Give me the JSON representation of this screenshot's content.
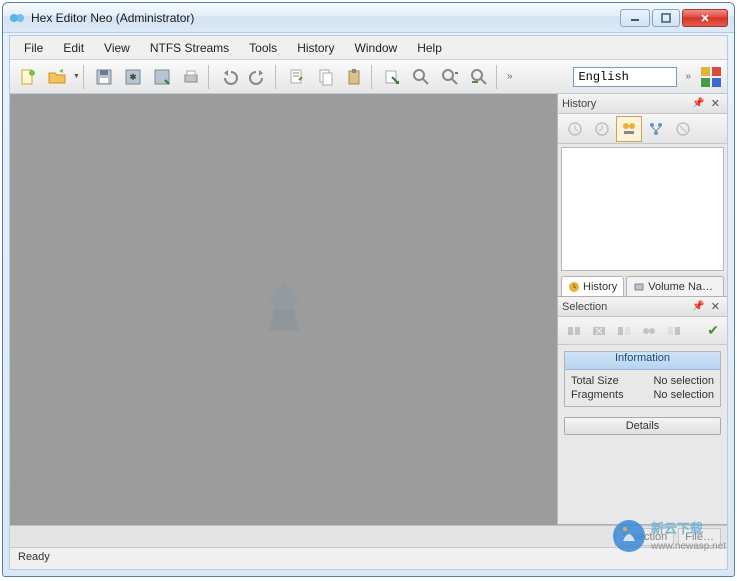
{
  "window": {
    "title": "Hex Editor Neo (Administrator)"
  },
  "menubar": {
    "items": [
      "File",
      "Edit",
      "View",
      "NTFS Streams",
      "Tools",
      "History",
      "Window",
      "Help"
    ]
  },
  "toolbar": {
    "language_value": "English"
  },
  "panels": {
    "history": {
      "title": "History",
      "tabs": {
        "history": "History",
        "volume": "Volume Na…"
      }
    },
    "selection": {
      "title": "Selection",
      "info_header": "Information",
      "rows": {
        "total_size_label": "Total Size",
        "total_size_value": "No selection",
        "fragments_label": "Fragments",
        "fragments_value": "No selection"
      },
      "details_label": "Details"
    }
  },
  "bottom_tabs": {
    "selection": "Selection",
    "file": "File…"
  },
  "status": {
    "text": "Ready"
  },
  "watermark": {
    "brand": "新云下载",
    "url": "www.newasp.net"
  }
}
